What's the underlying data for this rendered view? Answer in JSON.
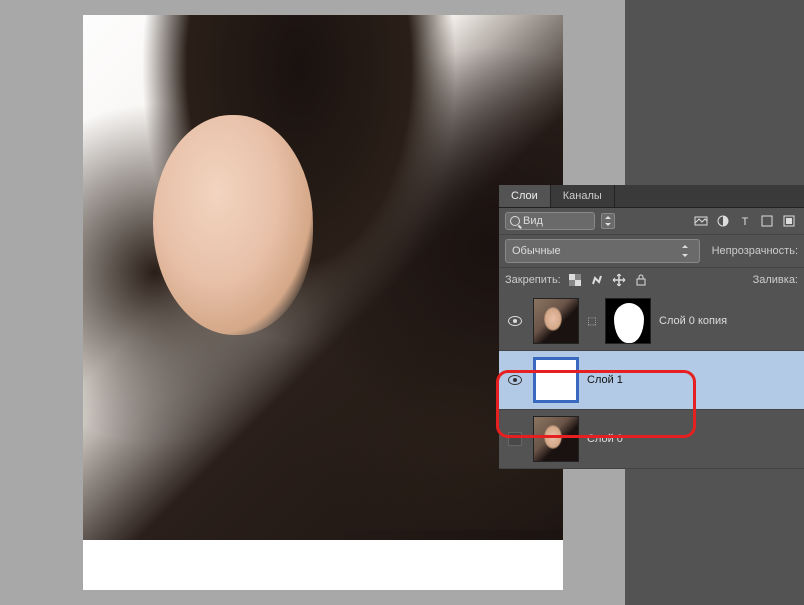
{
  "panel": {
    "tabs": {
      "layers": "Слои",
      "channels": "Каналы"
    },
    "search": {
      "label": "Вид"
    },
    "blend_mode": "Обычные",
    "opacity_label": "Непрозрачность:",
    "lock_label": "Закрепить:",
    "fill_label": "Заливка:"
  },
  "layers": [
    {
      "name": "Слой 0 копия",
      "visible": true,
      "selected": false,
      "has_mask": true
    },
    {
      "name": "Слой 1",
      "visible": true,
      "selected": true,
      "has_mask": false,
      "thumb": "white"
    },
    {
      "name": "Слой 0",
      "visible": false,
      "selected": false,
      "has_mask": false
    }
  ]
}
